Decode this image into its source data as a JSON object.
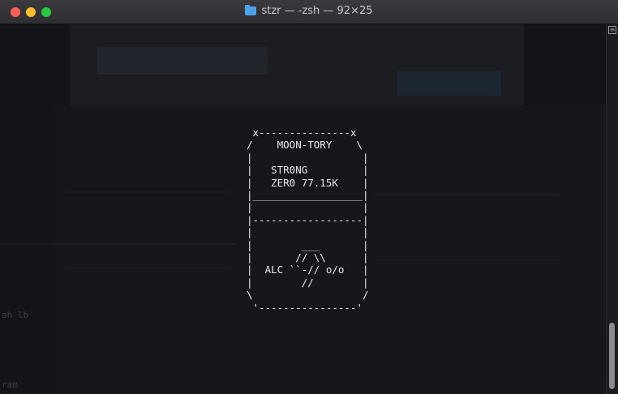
{
  "window": {
    "title": "stzr — -zsh — 92×25"
  },
  "terminal": {
    "ascii_lines": [
      " x---------------x",
      "/    MOON-TORY    \\",
      "|                  |",
      "|   STR0NG         |",
      "|   ZER0 77.15K    |",
      "|__________________|",
      "|                  |",
      "|------------------|",
      "|                  |",
      "|        ___       |",
      "|       // \\\\      |",
      "|  ALC ``-// o/o   |",
      "|        //        |",
      "\\                  /",
      " '----------------'"
    ],
    "background_fragments": [
      "ah lb",
      "ram"
    ]
  },
  "scrollbar": {
    "up_glyph": "≡"
  }
}
